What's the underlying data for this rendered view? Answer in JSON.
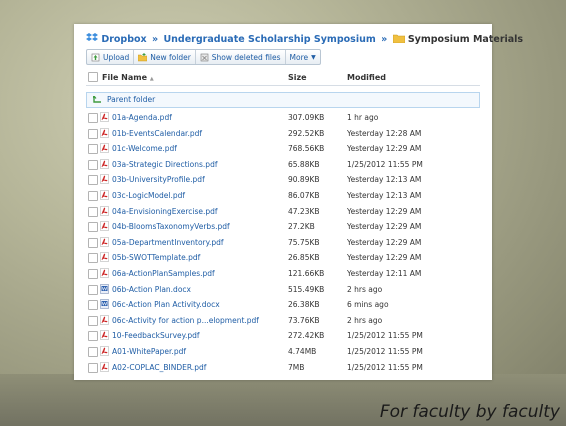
{
  "breadcrumb": {
    "root": "Dropbox",
    "folder": "Undergraduate Scholarship Symposium",
    "current": "Symposium Materials",
    "separator": "»"
  },
  "toolbar": {
    "upload": "Upload",
    "new_folder": "New folder",
    "show_deleted": "Show deleted files",
    "more": "More"
  },
  "columns": {
    "name": "File Name",
    "name_sort": "▲",
    "size": "Size",
    "modified": "Modified"
  },
  "parent_folder": "Parent folder",
  "files": [
    {
      "name": "01a-Agenda.pdf",
      "size": "307.09KB",
      "modified": "1 hr ago",
      "type": "pdf"
    },
    {
      "name": "01b-EventsCalendar.pdf",
      "size": "292.52KB",
      "modified": "Yesterday 12:28 AM",
      "type": "pdf"
    },
    {
      "name": "01c-Welcome.pdf",
      "size": "768.56KB",
      "modified": "Yesterday 12:29 AM",
      "type": "pdf"
    },
    {
      "name": "03a-Strategic Directions.pdf",
      "size": "65.88KB",
      "modified": "1/25/2012 11:55 PM",
      "type": "pdf"
    },
    {
      "name": "03b-UniversityProfile.pdf",
      "size": "90.89KB",
      "modified": "Yesterday 12:13 AM",
      "type": "pdf"
    },
    {
      "name": "03c-LogicModel.pdf",
      "size": "86.07KB",
      "modified": "Yesterday 12:13 AM",
      "type": "pdf"
    },
    {
      "name": "04a-EnvisioningExercise.pdf",
      "size": "47.23KB",
      "modified": "Yesterday 12:29 AM",
      "type": "pdf"
    },
    {
      "name": "04b-BloomsTaxonomyVerbs.pdf",
      "size": "27.2KB",
      "modified": "Yesterday 12:29 AM",
      "type": "pdf"
    },
    {
      "name": "05a-DepartmentInventory.pdf",
      "size": "75.75KB",
      "modified": "Yesterday 12:29 AM",
      "type": "pdf"
    },
    {
      "name": "05b-SWOTTemplate.pdf",
      "size": "26.85KB",
      "modified": "Yesterday 12:29 AM",
      "type": "pdf"
    },
    {
      "name": "06a-ActionPlanSamples.pdf",
      "size": "121.66KB",
      "modified": "Yesterday 12:11 AM",
      "type": "pdf"
    },
    {
      "name": "06b-Action Plan.docx",
      "size": "515.49KB",
      "modified": "2 hrs ago",
      "type": "docx"
    },
    {
      "name": "06c-Action Plan Activity.docx",
      "size": "26.38KB",
      "modified": "6 mins ago",
      "type": "docx"
    },
    {
      "name": "06c-Activity for action p...elopment.pdf",
      "size": "73.76KB",
      "modified": "2 hrs ago",
      "type": "pdf"
    },
    {
      "name": "10-FeedbackSurvey.pdf",
      "size": "272.42KB",
      "modified": "1/25/2012 11:55 PM",
      "type": "pdf"
    },
    {
      "name": "A01-WhitePaper.pdf",
      "size": "4.74MB",
      "modified": "1/25/2012 11:55 PM",
      "type": "pdf"
    },
    {
      "name": "A02-COPLAC_BINDER.pdf",
      "size": "7MB",
      "modified": "1/25/2012 11:55 PM",
      "type": "pdf"
    }
  ],
  "tagline": "For faculty by faculty",
  "colors": {
    "link": "#1f5da5",
    "pdf_icon": "#cc2222",
    "doc_icon": "#2f62b0",
    "folder": "#f0c040"
  }
}
